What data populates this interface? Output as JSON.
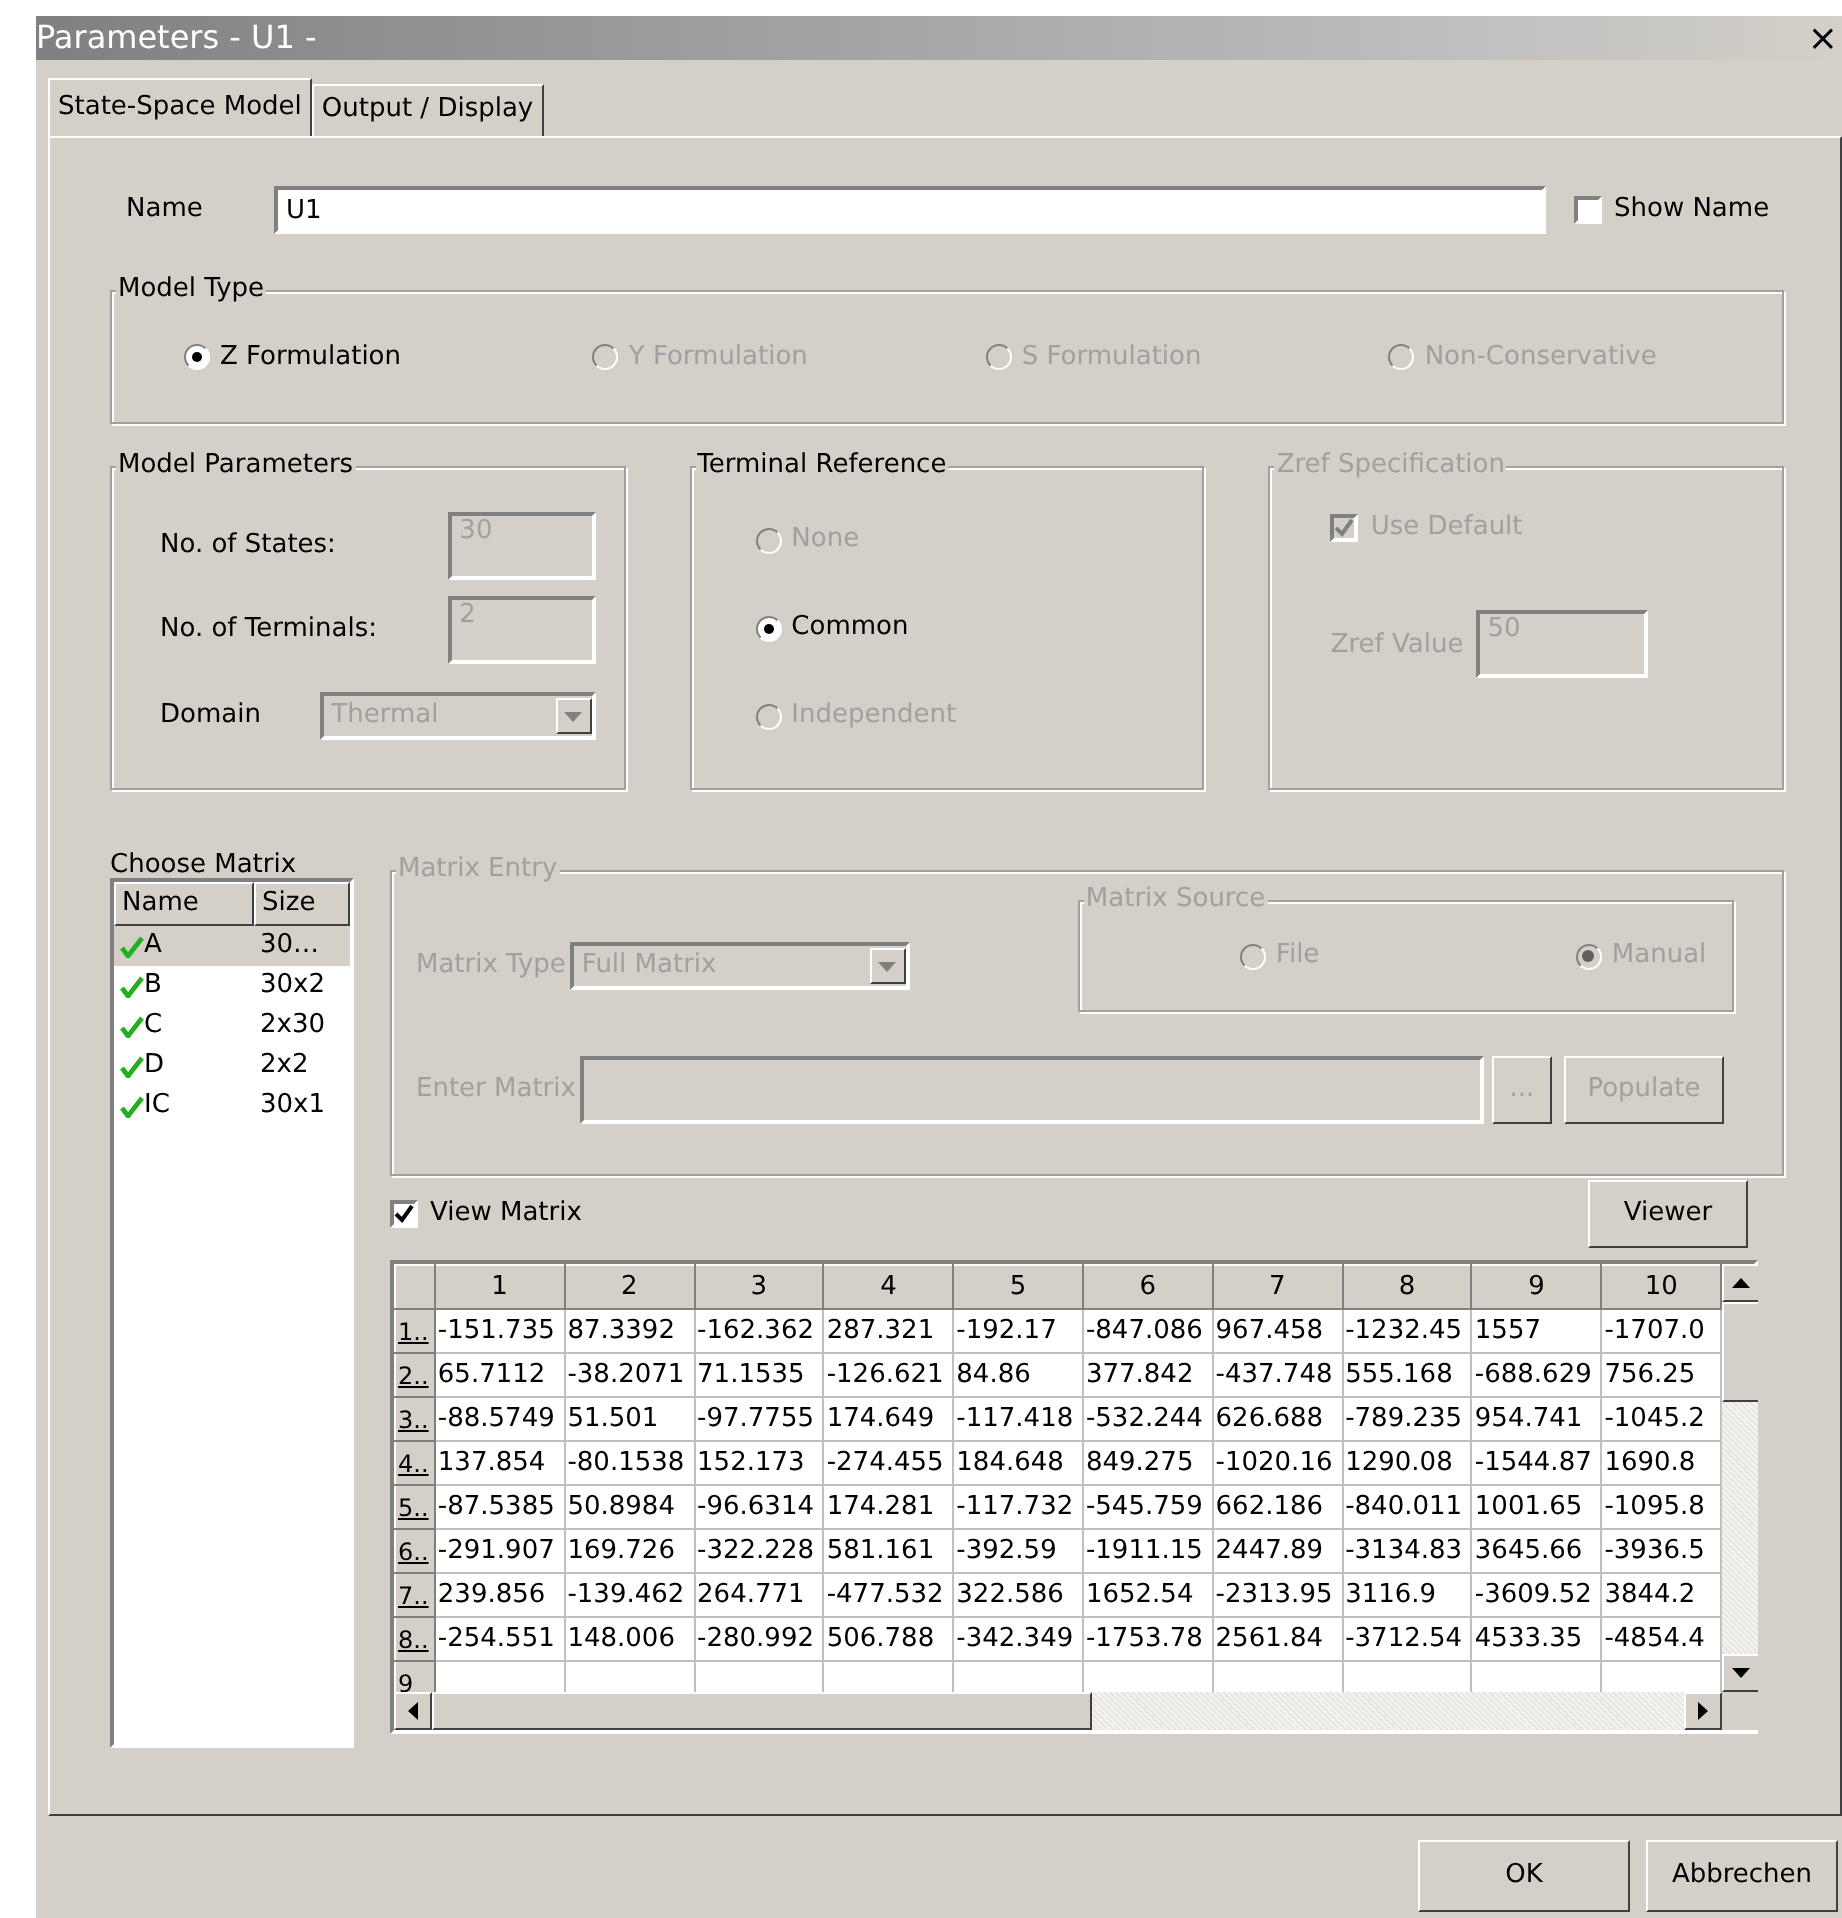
{
  "window": {
    "title": "Parameters - U1 -",
    "close": "×"
  },
  "tabs": [
    {
      "label": "State-Space Model",
      "selected": true
    },
    {
      "label": "Output / Display",
      "selected": false
    }
  ],
  "name_field": {
    "label": "Name",
    "value": "U1"
  },
  "show_name": {
    "label": "Show Name",
    "checked": false
  },
  "model_type": {
    "title": "Model Type",
    "options": [
      {
        "label": "Z Formulation",
        "selected": true,
        "disabled": false
      },
      {
        "label": "Y Formulation",
        "selected": false,
        "disabled": true
      },
      {
        "label": "S Formulation",
        "selected": false,
        "disabled": true
      },
      {
        "label": "Non-Conservative",
        "selected": false,
        "disabled": true
      }
    ]
  },
  "model_parameters": {
    "title": "Model Parameters",
    "states_label": "No. of States:",
    "states": "30",
    "terminals_label": "No. of Terminals:",
    "terminals": "2",
    "domain_label": "Domain",
    "domain": "Thermal"
  },
  "terminal_reference": {
    "title": "Terminal Reference",
    "options": [
      {
        "label": "None",
        "selected": false,
        "disabled": true
      },
      {
        "label": "Common",
        "selected": true,
        "disabled": false
      },
      {
        "label": "Independent",
        "selected": false,
        "disabled": true
      }
    ]
  },
  "zref": {
    "title": "Zref Specification",
    "use_default": {
      "label": "Use Default",
      "checked": true
    },
    "value_label": "Zref Value",
    "value": "50"
  },
  "choose_matrix": {
    "title": "Choose Matrix",
    "columns": [
      "Name",
      "Size"
    ],
    "items": [
      {
        "name": "A",
        "size": "30…",
        "selected": true
      },
      {
        "name": "B",
        "size": "30x2",
        "selected": false
      },
      {
        "name": "C",
        "size": "2x30",
        "selected": false
      },
      {
        "name": "D",
        "size": "2x2",
        "selected": false
      },
      {
        "name": "IC",
        "size": "30x1",
        "selected": false
      }
    ]
  },
  "matrix_entry": {
    "title": "Matrix Entry",
    "type_label": "Matrix Type",
    "type": "Full Matrix",
    "source_title": "Matrix Source",
    "sources": [
      {
        "label": "File",
        "selected": false
      },
      {
        "label": "Manual",
        "selected": true
      }
    ],
    "enter_label": "Enter Matrix",
    "browse": "...",
    "populate": "Populate"
  },
  "view_matrix": {
    "label": "View Matrix",
    "checked": true
  },
  "viewer_button": "Viewer",
  "matrix_table": {
    "columns": [
      "1",
      "2",
      "3",
      "4",
      "5",
      "6",
      "7",
      "8",
      "9",
      "10"
    ],
    "rows": [
      {
        "header": "1..",
        "cells": [
          "-151.735",
          "87.3392",
          "-162.362",
          "287.321",
          "-192.17",
          "-847.086",
          "967.458",
          "-1232.45",
          "1557",
          "-1707.0"
        ]
      },
      {
        "header": "2..",
        "cells": [
          "65.7112",
          "-38.2071",
          "71.1535",
          "-126.621",
          "84.86",
          "377.842",
          "-437.748",
          "555.168",
          "-688.629",
          "756.25"
        ]
      },
      {
        "header": "3..",
        "cells": [
          "-88.5749",
          "51.501",
          "-97.7755",
          "174.649",
          "-117.418",
          "-532.244",
          "626.688",
          "-789.235",
          "954.741",
          "-1045.2"
        ]
      },
      {
        "header": "4..",
        "cells": [
          "137.854",
          "-80.1538",
          "152.173",
          "-274.455",
          "184.648",
          "849.275",
          "-1020.16",
          "1290.08",
          "-1544.87",
          "1690.8"
        ]
      },
      {
        "header": "5..",
        "cells": [
          "-87.5385",
          "50.8984",
          "-96.6314",
          "174.281",
          "-117.732",
          "-545.759",
          "662.186",
          "-840.011",
          "1001.65",
          "-1095.8"
        ]
      },
      {
        "header": "6..",
        "cells": [
          "-291.907",
          "169.726",
          "-322.228",
          "581.161",
          "-392.59",
          "-1911.15",
          "2447.89",
          "-3134.83",
          "3645.66",
          "-3936.5"
        ]
      },
      {
        "header": "7..",
        "cells": [
          "239.856",
          "-139.462",
          "264.771",
          "-477.532",
          "322.586",
          "1652.54",
          "-2313.95",
          "3116.9",
          "-3609.52",
          "3844.2"
        ]
      },
      {
        "header": "8..",
        "cells": [
          "-254.551",
          "148.006",
          "-280.992",
          "506.788",
          "-342.349",
          "-1753.78",
          "2561.84",
          "-3712.54",
          "4533.35",
          "-4854.4"
        ]
      },
      {
        "header": "9",
        "cells": []
      }
    ]
  },
  "buttons": [
    "OK",
    "Abbrechen"
  ]
}
